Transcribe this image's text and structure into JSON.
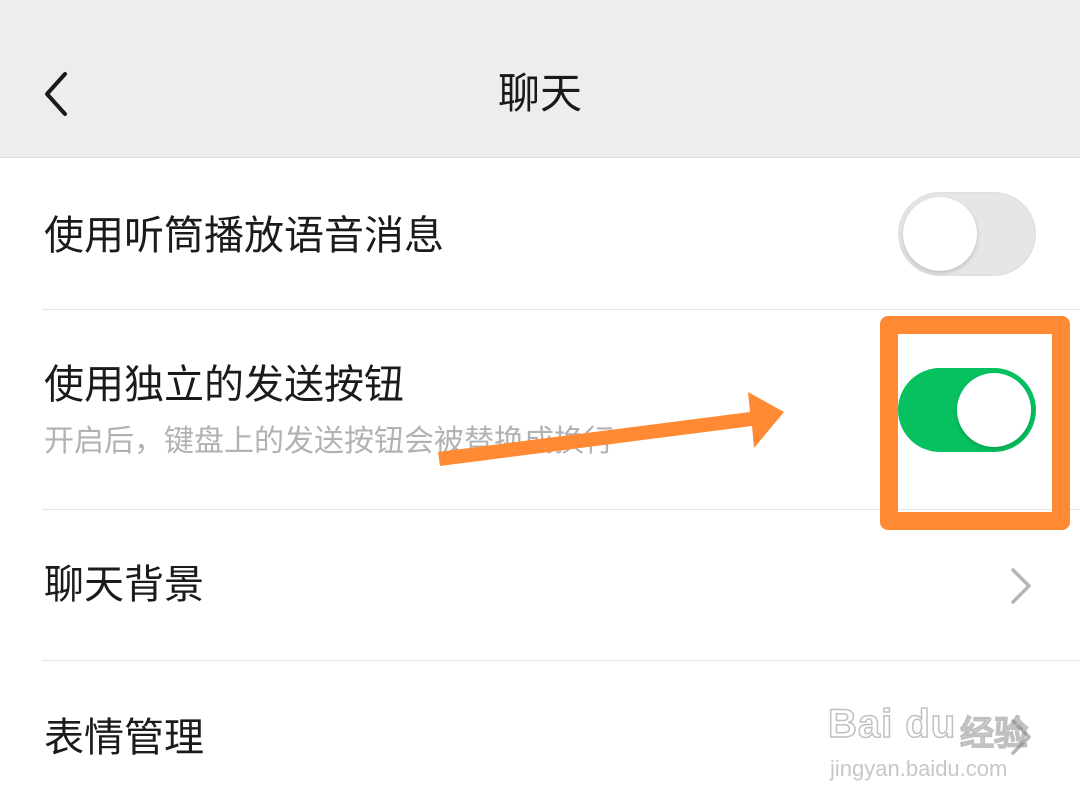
{
  "header": {
    "title": "聊天",
    "back_icon": "chevron-left-icon"
  },
  "settings": [
    {
      "label": "使用听筒播放语音消息",
      "control": "toggle",
      "enabled": false
    },
    {
      "label": "使用独立的发送按钮",
      "sublabel": "开启后，键盘上的发送按钮会被替换成换行",
      "control": "toggle",
      "enabled": true
    },
    {
      "label": "聊天背景",
      "control": "chevron-right-icon"
    },
    {
      "label": "表情管理",
      "control": "chevron-right-icon"
    }
  ],
  "annotation": {
    "arrow_color": "#ff8a33",
    "highlight_color": "#ff8a33"
  },
  "colors": {
    "nav_bg": "#ededed",
    "toggle_on": "#07c160",
    "toggle_off": "#e6e6e6"
  },
  "watermark": {
    "brand": "Bai du",
    "brand_cn": "经验",
    "url": "jingyan.baidu.com"
  }
}
